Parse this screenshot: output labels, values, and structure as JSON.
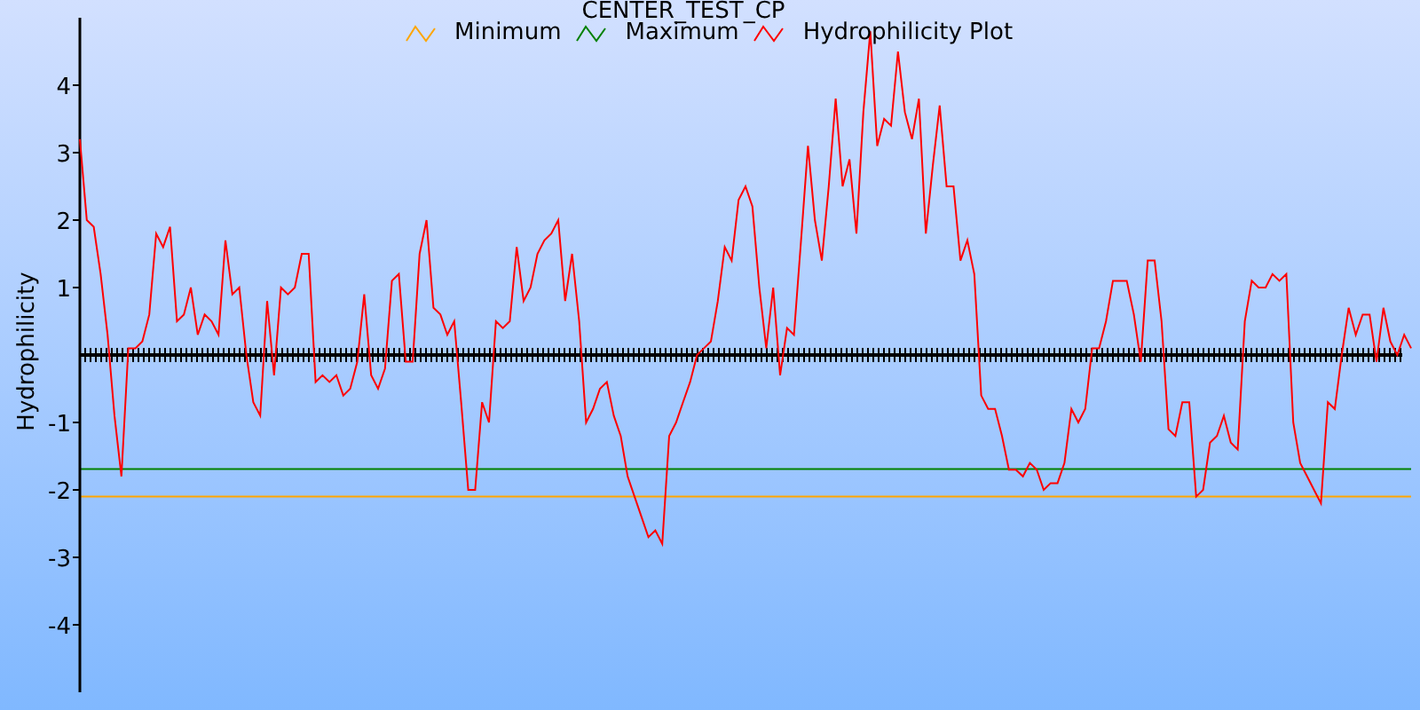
{
  "chart": {
    "chart_data": {
      "type": "line",
      "title": "CENTER_TEST_CP",
      "ylabel": "Hydrophilicity",
      "ylim": [
        -5,
        5
      ],
      "yticks": [
        -4,
        -3,
        -2,
        -1,
        1,
        2,
        3,
        4
      ],
      "categories": [
        null,
        null,
        null,
        null,
        null,
        null,
        null,
        null,
        null,
        null,
        null,
        null,
        null,
        null,
        null,
        null,
        null,
        null,
        null,
        null,
        null,
        null,
        null,
        null,
        null,
        null,
        null,
        null,
        null,
        null,
        null,
        null,
        null,
        null,
        null,
        null,
        null,
        null,
        null,
        null,
        null,
        null,
        null,
        null,
        null,
        null,
        null,
        null,
        null,
        null,
        null,
        null,
        null,
        null,
        null,
        null,
        null,
        null,
        null,
        null,
        null,
        null,
        null,
        null,
        null,
        null,
        null,
        null,
        null,
        null,
        null,
        null,
        null,
        null,
        null,
        null,
        null,
        null,
        null,
        null,
        null,
        null,
        null,
        null,
        null,
        null,
        null,
        null,
        null,
        null,
        null,
        null,
        null,
        null,
        null,
        null,
        null,
        null,
        null,
        null,
        null,
        null,
        null,
        null,
        null,
        null,
        null,
        null,
        null,
        null,
        null,
        null,
        null,
        null,
        null,
        null,
        null,
        null,
        null,
        null,
        null,
        null,
        null,
        null,
        null,
        null,
        null,
        null,
        null,
        null,
        null,
        null,
        null,
        null,
        null,
        null,
        null,
        null,
        null,
        null,
        null,
        null,
        null,
        null,
        null,
        null,
        null,
        null,
        null,
        null,
        null,
        null,
        null,
        null,
        null,
        null,
        null,
        null,
        null,
        null,
        null,
        null,
        null,
        null,
        null,
        null,
        null,
        null,
        null,
        null,
        null,
        null,
        null,
        null,
        null,
        null,
        null,
        null,
        null,
        null,
        null,
        null,
        null,
        null,
        null,
        null,
        null,
        null,
        null,
        null,
        null,
        null,
        null
      ],
      "series": [
        {
          "name": "Hydrophilicity Plot",
          "color": "#ff0000",
          "values": [
            3.2,
            2.0,
            1.9,
            1.2,
            0.3,
            -0.9,
            -1.8,
            0.1,
            0.1,
            0.2,
            0.6,
            1.8,
            1.6,
            1.9,
            0.5,
            0.6,
            1.0,
            0.3,
            0.6,
            0.5,
            0.3,
            1.7,
            0.9,
            1.0,
            0.0,
            -0.7,
            -0.9,
            0.8,
            -0.3,
            1.0,
            0.9,
            1.0,
            1.5,
            1.5,
            -0.4,
            -0.3,
            -0.4,
            -0.3,
            -0.6,
            -0.5,
            -0.1,
            0.9,
            -0.3,
            -0.5,
            -0.2,
            1.1,
            1.2,
            -0.1,
            -0.1,
            1.5,
            2.0,
            0.7,
            0.6,
            0.3,
            0.5,
            -0.7,
            -2.0,
            -2.0,
            -0.7,
            -1.0,
            0.5,
            0.4,
            0.5,
            1.6,
            0.8,
            1.0,
            1.5,
            1.7,
            1.8,
            2.0,
            0.8,
            1.5,
            0.5,
            -1.0,
            -0.8,
            -0.5,
            -0.4,
            -0.9,
            -1.2,
            -1.8,
            -2.1,
            -2.4,
            -2.7,
            -2.6,
            -2.8,
            -1.2,
            -1.0,
            -0.7,
            -0.4,
            0.0,
            0.1,
            0.2,
            0.8,
            1.6,
            1.4,
            2.3,
            2.5,
            2.2,
            1.0,
            0.1,
            1.0,
            -0.3,
            0.4,
            0.3,
            1.7,
            3.1,
            2.0,
            1.4,
            2.5,
            3.8,
            2.5,
            2.9,
            1.8,
            3.6,
            4.8,
            3.1,
            3.5,
            3.4,
            4.5,
            3.6,
            3.2,
            3.8,
            1.8,
            2.8,
            3.7,
            2.5,
            2.5,
            1.4,
            1.7,
            1.2,
            -0.6,
            -0.8,
            -0.8,
            -1.2,
            -1.7,
            -1.7,
            -1.8,
            -1.6,
            -1.7,
            -2.0,
            -1.9,
            -1.9,
            -1.6,
            -0.8,
            -1.0,
            -0.8,
            0.1,
            0.1,
            0.5,
            1.1,
            1.1,
            1.1,
            0.6,
            -0.1,
            1.4,
            1.4,
            0.5,
            -1.1,
            -1.2,
            -0.7,
            -0.7,
            -2.1,
            -2.0,
            -1.3,
            -1.2,
            -0.9,
            -1.3,
            -1.4,
            0.5,
            1.1,
            1.0,
            1.0,
            1.2,
            1.1,
            1.2,
            -1.0,
            -1.6,
            -1.8,
            -2.0,
            -2.2,
            -0.7,
            -0.8,
            0.0,
            0.7,
            0.3,
            0.6,
            0.6,
            -0.1,
            0.7,
            0.2,
            0.0,
            0.3,
            0.1
          ]
        }
      ],
      "ref_lines": [
        {
          "label": "Minimum",
          "axis": "y",
          "value": -2.1,
          "color": "#ffa500"
        },
        {
          "label": "Maximum",
          "axis": "y",
          "value": -1.69,
          "color": "#008000"
        }
      ]
    }
  }
}
